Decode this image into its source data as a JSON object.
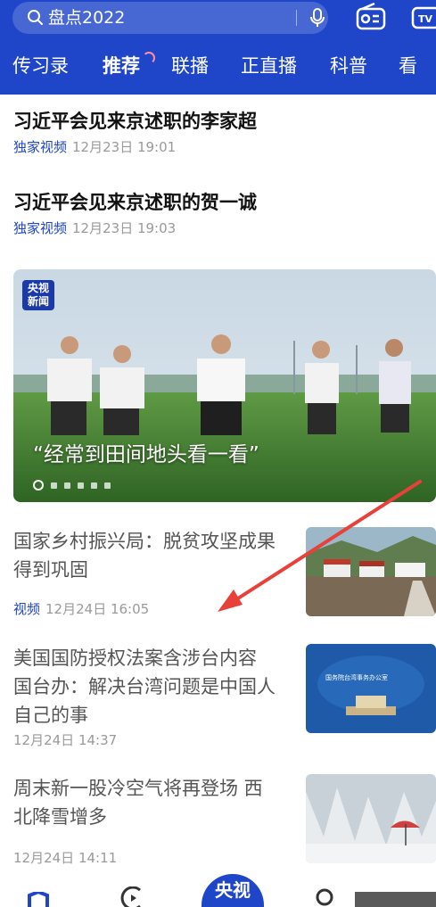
{
  "search": {
    "text": "盘点2022",
    "icon": "search-icon",
    "mic_icon": "mic-icon"
  },
  "header_icons": {
    "radio": "radio-icon",
    "tv": "tv-icon"
  },
  "tabs": [
    {
      "label": "传习录",
      "active": false
    },
    {
      "label": "推荐",
      "active": true
    },
    {
      "label": "联播",
      "active": false
    },
    {
      "label": "正直播",
      "active": false
    },
    {
      "label": "科普",
      "active": false
    },
    {
      "label": "看",
      "active": false
    }
  ],
  "headlines": [
    {
      "title": "习近平会见来京述职的李家超",
      "tag": "独家视频",
      "time": "12月23日 19:01"
    },
    {
      "title": "习近平会见来京述职的贺一诚",
      "tag": "独家视频",
      "time": "12月23日 19:03"
    }
  ],
  "banner": {
    "logo_line1": "央视",
    "logo_line2": "新闻",
    "caption": "“经常到田间地头看一看”",
    "slide_count": 6,
    "active_slide": 0
  },
  "news": [
    {
      "title": "国家乡村振兴局：脱贫攻坚成果得到巩固",
      "tag": "视频",
      "time": "12月24日 16:05"
    },
    {
      "title": "美国国防授权法案含涉台内容 国台办：解决台湾问题是中国人自己的事",
      "tag": "",
      "time": "12月24日 14:37"
    },
    {
      "title": "周末新一股冷空气将再登场 西北降雪增多",
      "tag": "",
      "time": "12月24日 14:11"
    }
  ],
  "thumb2_text": "国务院台湾事务办公室",
  "bottom_nav": {
    "center_label": "央视"
  },
  "colors": {
    "brand": "#1f46c9",
    "arrow": "#e8413a",
    "tag": "#1f46c9",
    "meta": "#9a9a9a"
  }
}
